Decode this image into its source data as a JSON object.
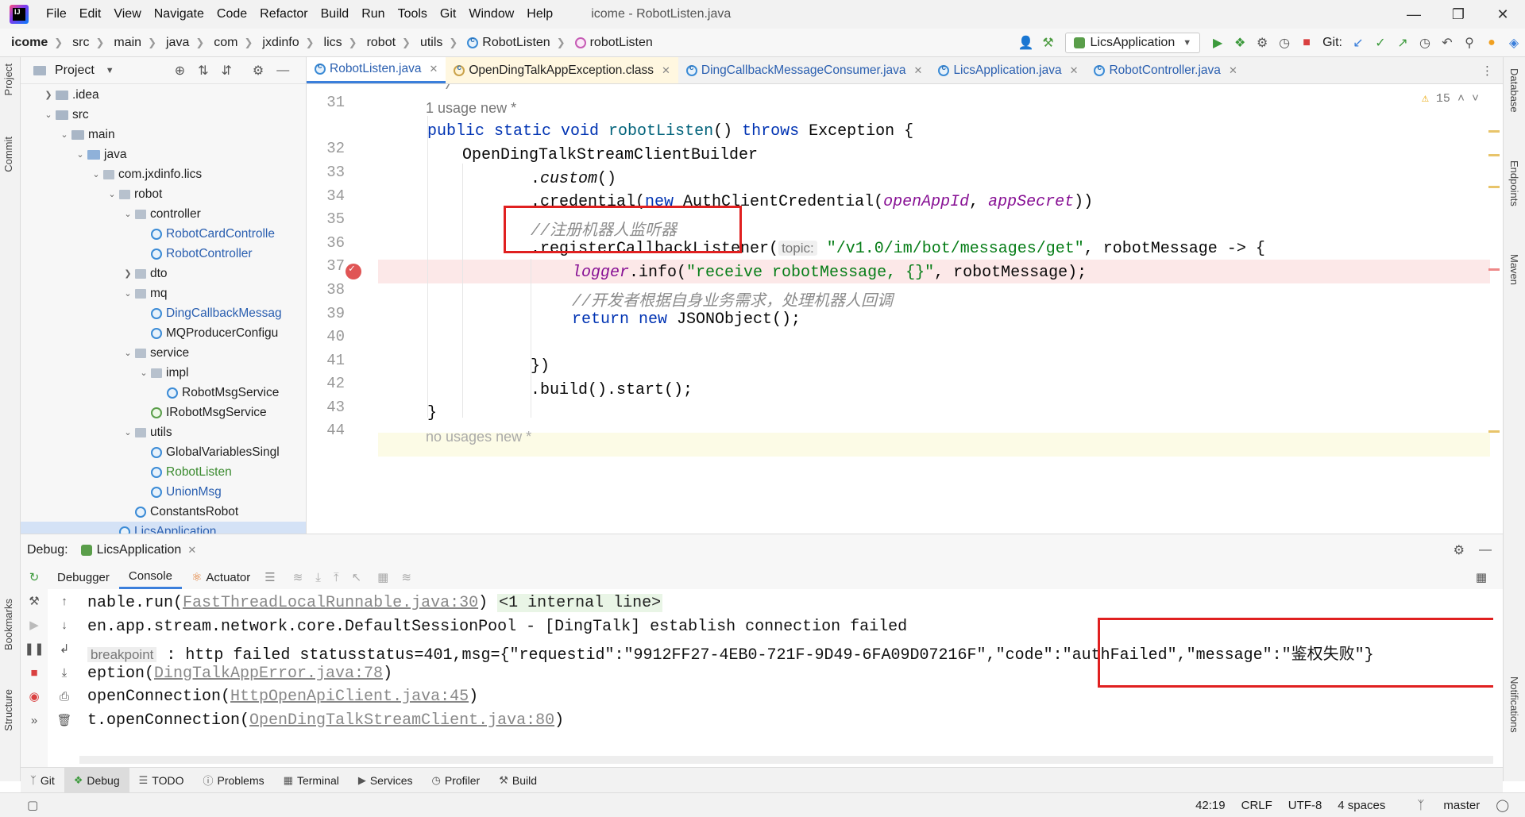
{
  "menubar": {
    "items": [
      "File",
      "Edit",
      "View",
      "Navigate",
      "Code",
      "Refactor",
      "Build",
      "Run",
      "Tools",
      "Git",
      "Window",
      "Help"
    ],
    "window_title": "icome - RobotListen.java"
  },
  "breadcrumb": [
    "icome",
    "src",
    "main",
    "java",
    "com",
    "jxdinfo",
    "lics",
    "robot",
    "utils",
    "RobotListen",
    "robotListen"
  ],
  "toolbar": {
    "run_config": "LicsApplication",
    "git_label": "Git:"
  },
  "project": {
    "title": "Project",
    "tree": [
      {
        "label": ".idea",
        "kind": "folder"
      },
      {
        "label": "src",
        "kind": "folder"
      },
      {
        "label": "main",
        "kind": "folder"
      },
      {
        "label": "java",
        "kind": "folder"
      },
      {
        "label": "com.jxdinfo.lics",
        "kind": "package"
      },
      {
        "label": "robot",
        "kind": "package"
      },
      {
        "label": "controller",
        "kind": "package"
      },
      {
        "label": "RobotCardControlle",
        "kind": "class"
      },
      {
        "label": "RobotController",
        "kind": "class"
      },
      {
        "label": "dto",
        "kind": "package"
      },
      {
        "label": "mq",
        "kind": "package"
      },
      {
        "label": "DingCallbackMessag",
        "kind": "class"
      },
      {
        "label": "MQProducerConfigu",
        "kind": "class"
      },
      {
        "label": "service",
        "kind": "package"
      },
      {
        "label": "impl",
        "kind": "package"
      },
      {
        "label": "RobotMsgService",
        "kind": "class"
      },
      {
        "label": "IRobotMsgService",
        "kind": "interface"
      },
      {
        "label": "utils",
        "kind": "package"
      },
      {
        "label": "GlobalVariablesSingl",
        "kind": "class"
      },
      {
        "label": "RobotListen",
        "kind": "class"
      },
      {
        "label": "UnionMsg",
        "kind": "class"
      },
      {
        "label": "ConstantsRobot",
        "kind": "class"
      },
      {
        "label": "LicsApplication",
        "kind": "class"
      }
    ]
  },
  "editor": {
    "tabs": [
      "RobotListen.java",
      "OpenDingTalkAppException.class",
      "DingCallbackMessageConsumer.java",
      "LicsApplication.java",
      "RobotController.java"
    ],
    "warning_count": "15",
    "usage_hint": "1 usage   new *",
    "usage_hint_bottom": "no usages   new *",
    "line_numbers": [
      "31",
      "32",
      "33",
      "34",
      "35",
      "36",
      "37",
      "38",
      "39",
      "40",
      "41",
      "42",
      "43",
      "44"
    ],
    "code": {
      "l31": "*/",
      "l32_kw": "public static void ",
      "l32_fn": "robotListen",
      "l32_rest": "() ",
      "l32_throws": "throws ",
      "l32_tail": "Exception {",
      "l33": "OpenDingTalkStreamClientBuilder",
      "l34_dot": ".",
      "l34_fn": "custom",
      "l34_tail": "()",
      "l35_a": ".credential(",
      "l35_new": "new ",
      "l35_b": "AuthClientCredential(",
      "l35_p1": "openAppId",
      "l35_c": ", ",
      "l35_p2": "appSecret",
      "l35_d": "))",
      "l36": "//注册机器人监听器",
      "l37_a": ".registerCallbackListener(",
      "l37_hint": "topic:",
      "l37_str": "\"/v1.0/im/bot/messages/get\"",
      "l37_b": ", robotMessage -> {",
      "l38_logger": "logger",
      "l38_a": ".info(",
      "l38_str": "\"receive robotMessage, {}\"",
      "l38_b": ", robotMessage);",
      "l39": "//开发者根据自身业务需求，处理机器人回调",
      "l40_kw": "return new ",
      "l40_tail": "JSONObject();",
      "l42": "})",
      "l43": ".build().start();",
      "l44": "}"
    }
  },
  "debug": {
    "label": "Debug:",
    "config": "LicsApplication",
    "subtabs": [
      "Debugger",
      "Console",
      "Actuator"
    ],
    "console": {
      "line1_a": "nable.run(",
      "line1_link": "FastThreadLocalRunnable.java:30",
      "line1_b": ") ",
      "line1_internal": "<1 internal line>",
      "line2": "en.app.stream.network.core.DefaultSessionPool - [DingTalk] establish connection failed",
      "line3_tag": "breakpoint",
      "line3": " : http failed statusstatus=401,msg={\"requestid\":\"9912FF27-4EB0-721F-9D49-6FA09D07216F\",\"code\":\"authFailed\",\"message\":\"鉴权失败\"}",
      "line4_a": "eption(",
      "line4_link": "DingTalkAppError.java:78",
      "line4_b": ")",
      "line5_a": "openConnection(",
      "line5_link": "HttpOpenApiClient.java:45",
      "line5_b": ")",
      "line6_a": "t.openConnection(",
      "line6_link": "OpenDingTalkStreamClient.java:80",
      "line6_b": ")"
    }
  },
  "tool_tabs": [
    "Git",
    "Debug",
    "TODO",
    "Problems",
    "Terminal",
    "Services",
    "Profiler",
    "Build"
  ],
  "left_stripe": [
    "Project",
    "Commit",
    "Bookmarks",
    "Structure"
  ],
  "right_stripe": [
    "Database",
    "Endpoints",
    "Maven",
    "Notifications"
  ],
  "statusbar": {
    "position": "42:19",
    "line_sep": "CRLF",
    "encoding": "UTF-8",
    "indent": "4 spaces",
    "branch": "master"
  },
  "colors": {
    "accent": "#3b7fdb",
    "annotation_red": "#e02020",
    "breakpoint_line": "#fce8e8"
  }
}
